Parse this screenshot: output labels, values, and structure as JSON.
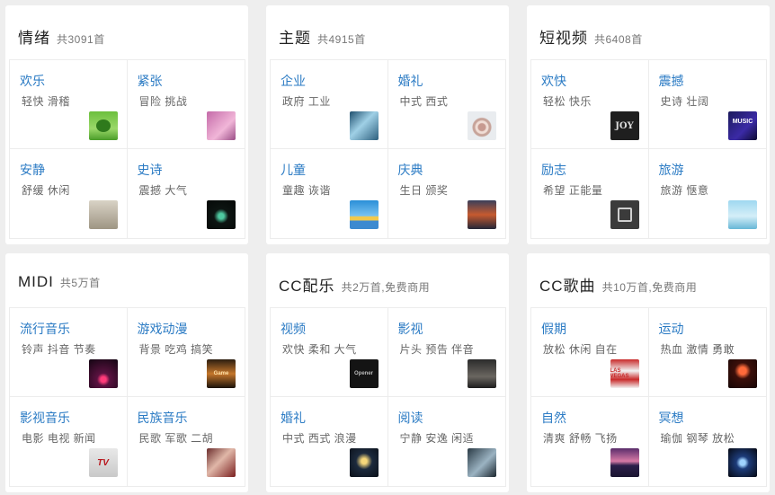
{
  "cards": [
    {
      "title": "情绪",
      "count": "共3091首",
      "items": [
        {
          "name": "欢乐",
          "tags": "轻快 滑稽",
          "icon": "tree-thumbnail"
        },
        {
          "name": "紧张",
          "tags": "冒险 挑战",
          "icon": "pink-figure-thumbnail"
        },
        {
          "name": "安静",
          "tags": "舒缓 休闲",
          "icon": "love-book-thumbnail"
        },
        {
          "name": "史诗",
          "tags": "震撼 大气",
          "icon": "dark-glow-thumbnail"
        }
      ]
    },
    {
      "title": "主题",
      "count": "共4915首",
      "items": [
        {
          "name": "企业",
          "tags": "政府 工业",
          "icon": "skyscraper-thumbnail"
        },
        {
          "name": "婚礼",
          "tags": "中式 西式",
          "icon": "heart-sand-thumbnail"
        },
        {
          "name": "儿童",
          "tags": "童趣 诙谐",
          "icon": "sky-cartoon-thumbnail"
        },
        {
          "name": "庆典",
          "tags": "生日 颁奖",
          "icon": "hot-air-balloon-thumbnail"
        }
      ]
    },
    {
      "title": "短视频",
      "count": "共6408首",
      "items": [
        {
          "name": "欢快",
          "tags": "轻松 快乐",
          "icon": "joy-letters-thumbnail",
          "glyph": "JOY"
        },
        {
          "name": "震撼",
          "tags": "史诗 壮阔",
          "icon": "music-poster-thumbnail",
          "glyph": "MUSIC"
        },
        {
          "name": "励志",
          "tags": "希望 正能量",
          "icon": "badge-thumbnail"
        },
        {
          "name": "旅游",
          "tags": "旅游 惬意",
          "icon": "seaside-thumbnail"
        }
      ]
    },
    {
      "title": "MIDI",
      "count": "共5万首",
      "items": [
        {
          "name": "流行音乐",
          "tags": "铃声 抖音 节奏",
          "icon": "concert-thumbnail"
        },
        {
          "name": "游戏动漫",
          "tags": "背景 吃鸡 搞笑",
          "icon": "game-logo-thumbnail",
          "glyph": "Game"
        },
        {
          "name": "影视音乐",
          "tags": "电影 电视 新闻",
          "icon": "tv-logo-thumbnail",
          "glyph": "TV"
        },
        {
          "name": "民族音乐",
          "tags": "民歌 军歌 二胡",
          "icon": "opera-mask-thumbnail"
        }
      ]
    },
    {
      "title": "CC配乐",
      "count": "共2万首,免费商用",
      "items": [
        {
          "name": "视频",
          "tags": "欢快 柔和 大气",
          "icon": "video-title-thumbnail",
          "glyph": "Opener"
        },
        {
          "name": "影视",
          "tags": "片头 预告 伴音",
          "icon": "film-person-thumbnail"
        },
        {
          "name": "婚礼",
          "tags": "中式 西式 浪漫",
          "icon": "night-lights-thumbnail"
        },
        {
          "name": "阅读",
          "tags": "宁静 安逸 闲适",
          "icon": "reading-thumbnail"
        }
      ]
    },
    {
      "title": "CC歌曲",
      "count": "共10万首,免费商用",
      "items": [
        {
          "name": "假期",
          "tags": "放松 休闲 自在",
          "icon": "las-vegas-sign-thumbnail",
          "glyph": "LAS VEGAS"
        },
        {
          "name": "运动",
          "tags": "热血 激情 勇敢",
          "icon": "runner-thumbnail"
        },
        {
          "name": "自然",
          "tags": "清爽 舒畅 飞扬",
          "icon": "sunset-thumbnail"
        },
        {
          "name": "冥想",
          "tags": "瑜伽 钢琴 放松",
          "icon": "galaxy-thumbnail"
        }
      ]
    }
  ]
}
